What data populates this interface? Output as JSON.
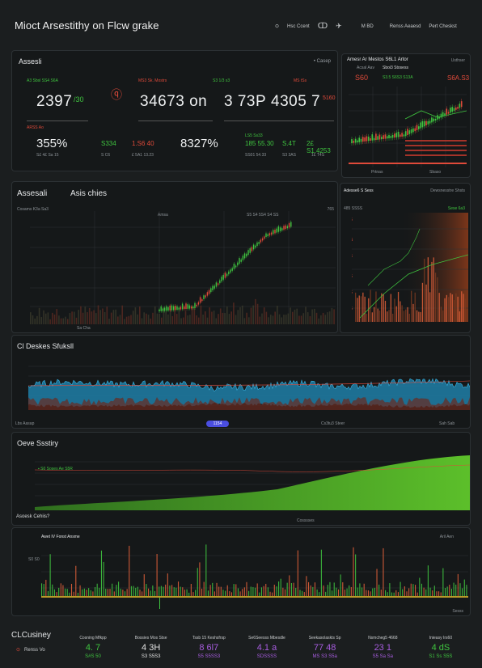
{
  "header": {
    "title": "Mioct Arsestithy on Flcw grake",
    "nav": [
      "Hsc Ccent",
      "M BD",
      "Renss Aeaesd",
      "Pert Cheskst"
    ]
  },
  "summary": {
    "title": "Assesli",
    "action": "Casep",
    "kpis": [
      {
        "label": "A3 Sbsl SS4 S6A",
        "value": "2397",
        "delta": "/30"
      },
      {
        "label": "MS3 Sk. Mostrs",
        "value": "34673 on",
        "delta": ""
      },
      {
        "label": "S3 1/3 s3",
        "value": "3 73P",
        "delta": ""
      },
      {
        "label": "MS tSs",
        "value": "4305 7",
        "delta": "5160"
      }
    ],
    "row2_label": "ARSS Ao",
    "row2": [
      {
        "value": "355%",
        "sub": "S£ 4£ Sa 15",
        "accent": "S334",
        "accent2": "S C6"
      },
      {
        "value": "1.S6 40",
        "sub": "£ 5A1 13.23"
      },
      {
        "value": "8327%",
        "sub": ""
      },
      {
        "value": "LS5 Ss33",
        "sub": "185 55.30",
        "extra": "SS01 54.33"
      },
      {
        "value": "S.4T",
        "sub": "S3 3AS"
      },
      {
        "value": "2£ S1.4253",
        "sub": "1£ T4S"
      }
    ]
  },
  "side_top": {
    "title": "Amesr Ar Mestos S6L1 Artor",
    "action": "Usthser",
    "labels": [
      "Acsal Aav",
      "Sboi3 Stosess",
      "S60",
      "S3.5 S6S3 S13A",
      "S6A.S3"
    ],
    "footer": [
      "Prtnas",
      "Sbaso"
    ]
  },
  "main_chart": {
    "title": "Assesali",
    "tab": "Asis chies",
    "sublabel": "Cosams K3a Sa3",
    "right_label": "765",
    "mid_labels": [
      "Amsa",
      "S5 S4 5S4 S4 SS"
    ],
    "footer": [
      "Sa Cha"
    ]
  },
  "side_mid": {
    "title": "Adesse6 S Sess",
    "action": "Dewsnesstre Shsts",
    "y_label": "485 SSSS",
    "legend": "Sese 6a3"
  },
  "wave": {
    "title": "Cl Deskes Sfuksll",
    "button": "1154",
    "foot_left": "Lbs Aasap",
    "foot_mid": "Cs3tu3 Steer",
    "foot_right": "Sah Sab"
  },
  "area": {
    "title": "Oeve Ssstiry",
    "legend": "S0 Soses Ae S5R",
    "foot_left": "Asoesk Cehiis?",
    "foot_mid": "Cosssses"
  },
  "bars": {
    "title": "Awet IV Fonst Ansme",
    "right": "Aril Aen",
    "y_label": "S0 S0",
    "foot": "Sesss"
  },
  "footer": {
    "title": "CLCusiney",
    "link": "Renss Vo",
    "stats": [
      {
        "label": "Cosning Mfkpp",
        "value": "4. 7",
        "sub": "S#S 50",
        "color": "#3fc43f"
      },
      {
        "label": "Bossies Mos Stse",
        "value": "4 3H",
        "sub": "S3 S5S3",
        "color": "#e0e0e0"
      },
      {
        "label": "Tssb 15 Keshsfrsp",
        "value": "8 6l7",
        "sub": "S5 S5SS3",
        "color": "#a85de0"
      },
      {
        "label": "Se6Seesss Mbesdle",
        "value": "4.1 a",
        "sub": "SDSSSS",
        "color": "#a85de0"
      },
      {
        "label": "Seekasolaskts Sp",
        "value": "77 48",
        "sub": "MS S3 S5a",
        "color": "#a85de0"
      },
      {
        "label": "Nsmcheg5 4668",
        "value": "23 1",
        "sub": "S5 Sa Sa",
        "color": "#a85de0"
      },
      {
        "label": "Inieasy Irs60",
        "value": "4 dS",
        "sub": "S1 Ss S5S",
        "color": "#3fc43f"
      }
    ]
  }
}
